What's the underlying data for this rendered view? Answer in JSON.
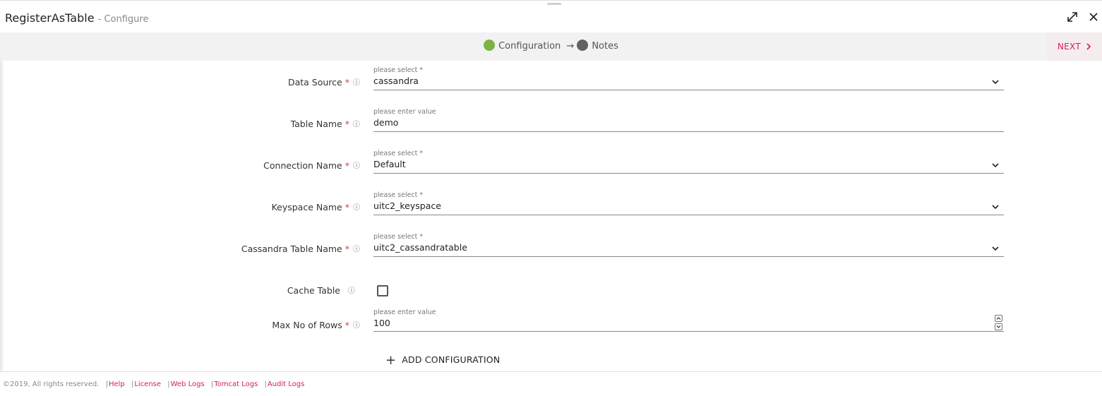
{
  "header": {
    "title": "RegisterAsTable",
    "subtitle": "- Configure"
  },
  "steps": {
    "step1": "Configuration",
    "arrow": "→",
    "step2": "Notes",
    "next_label": "NEXT",
    "colors": {
      "active": "#7cb342",
      "inactive": "#616161",
      "accent": "#d81b60"
    }
  },
  "form": {
    "data_source": {
      "label": "Data Source",
      "hint": "please select *",
      "value": "cassandra"
    },
    "table_name": {
      "label": "Table Name",
      "hint": "please enter value",
      "value": "demo"
    },
    "connection_name": {
      "label": "Connection Name",
      "hint": "please select *",
      "value": "Default"
    },
    "keyspace_name": {
      "label": "Keyspace Name",
      "hint": "please select *",
      "value": "uitc2_keyspace"
    },
    "cassandra_table_name": {
      "label": "Cassandra Table Name",
      "hint": "please select *",
      "value": "uitc2_cassandratable"
    },
    "cache_table": {
      "label": "Cache Table",
      "checked": false
    },
    "max_rows": {
      "label": "Max No of Rows",
      "hint": "please enter value",
      "value": "100"
    },
    "required_mark": "*",
    "info_icon": "ⓘ",
    "add_configuration": "ADD CONFIGURATION"
  },
  "footer": {
    "copyright": "©2019, All rights reserved.",
    "sep": "|",
    "links": [
      "Help",
      "License",
      "Web Logs",
      "Tomcat Logs",
      "Audit Logs"
    ]
  }
}
